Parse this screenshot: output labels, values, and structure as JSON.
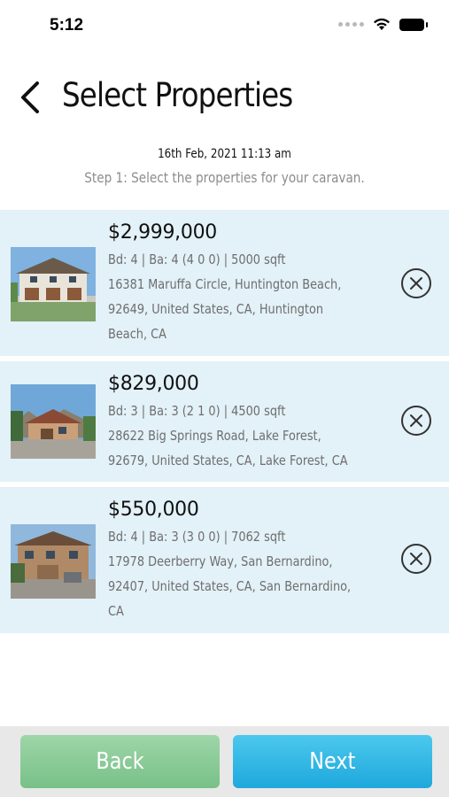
{
  "status_bar": {
    "time": "5:12"
  },
  "header": {
    "title": "Select Properties"
  },
  "meta": {
    "datetime": "16th Feb, 2021 11:13 am",
    "step_text": "Step 1: Select the properties for your caravan."
  },
  "properties": [
    {
      "price": "$2,999,000",
      "specs": "Bd: 4 | Ba: 4 (4 0 0) | 5000 sqft",
      "address_lines": [
        "16381 Maruffa Circle, Huntington Beach,",
        "92649, United States, CA, Huntington",
        "Beach, CA"
      ]
    },
    {
      "price": "$829,000",
      "specs": "Bd: 3 | Ba: 3 (2 1 0) | 4500 sqft",
      "address_lines": [
        "28622 Big Springs Road, Lake Forest,",
        "92679, United States, CA, Lake Forest, CA"
      ]
    },
    {
      "price": "$550,000",
      "specs": "Bd: 4 | Ba: 3 (3 0 0) | 7062 sqft",
      "address_lines": [
        "17978 Deerberry Way, San Bernardino,",
        "92407, United States, CA, San Bernardino,",
        "CA"
      ]
    }
  ],
  "footer": {
    "back_label": "Back",
    "next_label": "Next"
  },
  "colors": {
    "card_bg": "#e3f1f8",
    "back_button": "#8ccb98",
    "next_button": "#33b8e5"
  }
}
